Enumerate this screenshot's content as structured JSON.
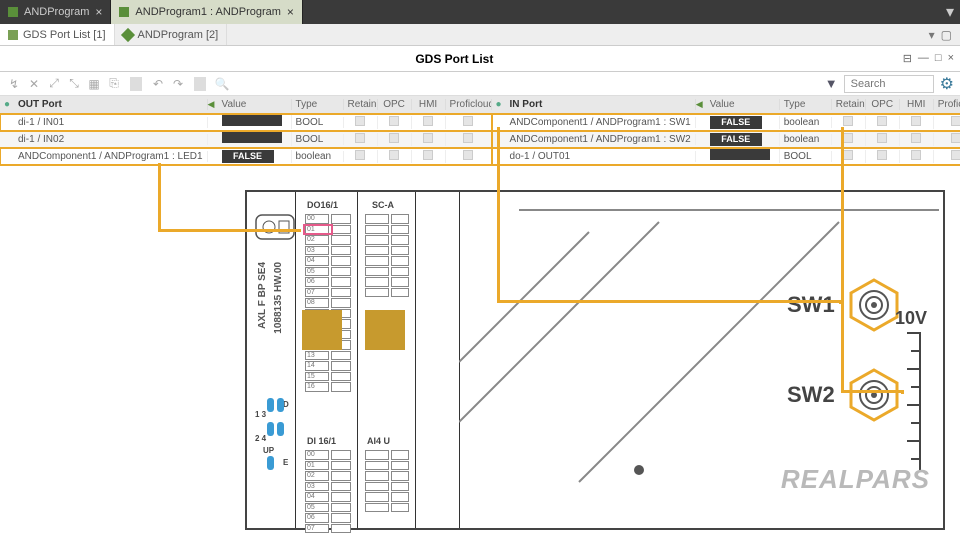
{
  "topTabs": [
    {
      "label": "ANDProgram",
      "active": false
    },
    {
      "label": "ANDProgram1 : ANDProgram",
      "active": true
    }
  ],
  "subTabs": [
    {
      "label": "GDS Port List [1]",
      "active": true,
      "iconColor": "#7aa055"
    },
    {
      "label": "ANDProgram [2]",
      "active": false,
      "iconColor": "#5a8f3a"
    }
  ],
  "panelTitle": "GDS Port List",
  "searchPlaceholder": "Search",
  "outHeader": "OUT Port",
  "inHeader": "IN Port",
  "cols": {
    "value": "Value",
    "type": "Type",
    "retain": "Retain",
    "opc": "OPC",
    "hmi": "HMI",
    "proficloud": "Proficloud"
  },
  "outRows": [
    {
      "name": "di-1 / IN01",
      "value": "",
      "type": "BOOL",
      "hl": true
    },
    {
      "name": "di-1 / IN02",
      "value": "",
      "type": "BOOL",
      "hl": false
    },
    {
      "name": "ANDComponent1 / ANDProgram1 : LED1",
      "value": "FALSE",
      "type": "boolean",
      "hl": true
    }
  ],
  "inRows": [
    {
      "name": "ANDComponent1 / ANDProgram1 : SW1",
      "value": "FALSE",
      "type": "boolean",
      "hl": true
    },
    {
      "name": "ANDComponent1 / ANDProgram1 : SW2",
      "value": "FALSE",
      "type": "boolean",
      "hl": true
    },
    {
      "name": "do-1 / OUT01",
      "value": "",
      "type": "BOOL",
      "hl": true
    }
  ],
  "hw": {
    "mod1": "DO16/1",
    "mod2": "SC-A",
    "mod3": "DI 16/1",
    "mod4": "AI4 U",
    "sideText1": "AXL  F  BP  SE4",
    "sideText2": "1088135   HW.00",
    "sw1": "SW1",
    "sw2": "SW2",
    "volt": "10V",
    "leftNums": [
      "1 3",
      "2 4",
      "UP"
    ],
    "leftLetters": [
      "D",
      "E"
    ]
  },
  "watermark": "REALPARS"
}
